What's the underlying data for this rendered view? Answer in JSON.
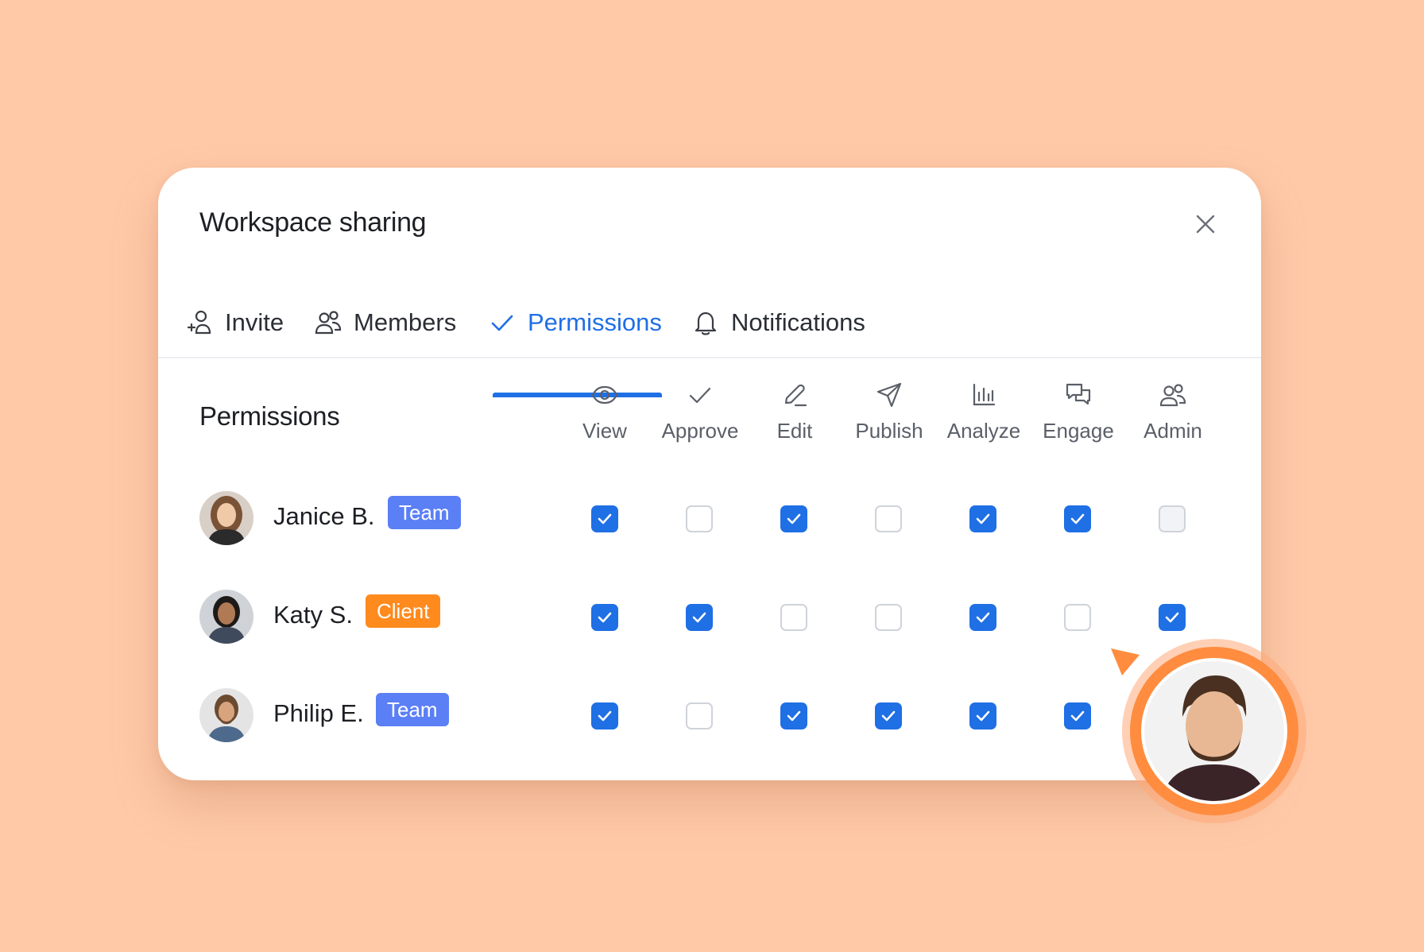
{
  "modal": {
    "title": "Workspace sharing",
    "close_icon": "close-icon"
  },
  "tabs": [
    {
      "label": "Invite",
      "icon": "add-user-icon",
      "active": false
    },
    {
      "label": "Members",
      "icon": "users-icon",
      "active": false
    },
    {
      "label": "Permissions",
      "icon": "check-icon",
      "active": true
    },
    {
      "label": "Notifications",
      "icon": "bell-icon",
      "active": false
    }
  ],
  "permissions": {
    "heading": "Permissions",
    "columns": [
      {
        "label": "View",
        "icon": "eye-icon"
      },
      {
        "label": "Approve",
        "icon": "check-icon"
      },
      {
        "label": "Edit",
        "icon": "pencil-icon"
      },
      {
        "label": "Publish",
        "icon": "send-icon"
      },
      {
        "label": "Analyze",
        "icon": "bar-chart-icon"
      },
      {
        "label": "Engage",
        "icon": "chat-icon"
      },
      {
        "label": "Admin",
        "icon": "users-icon"
      }
    ],
    "rows": [
      {
        "name": "Janice B.",
        "badge": "Team",
        "badge_type": "team",
        "checks": [
          "on",
          "off",
          "on",
          "off",
          "on",
          "on",
          "disabled"
        ]
      },
      {
        "name": "Katy S.",
        "badge": "Client",
        "badge_type": "client",
        "checks": [
          "on",
          "on",
          "off",
          "off",
          "on",
          "off",
          "on"
        ]
      },
      {
        "name": "Philip E.",
        "badge": "Team",
        "badge_type": "team",
        "checks": [
          "on",
          "off",
          "on",
          "on",
          "on",
          "on",
          null
        ]
      }
    ]
  },
  "colors": {
    "background": "#FFC9A8",
    "accent": "#1F6FE5",
    "team_badge": "#5B7FF5",
    "client_badge": "#FF8A1D",
    "cursor_avatar_ring": "#FF8C3F"
  }
}
